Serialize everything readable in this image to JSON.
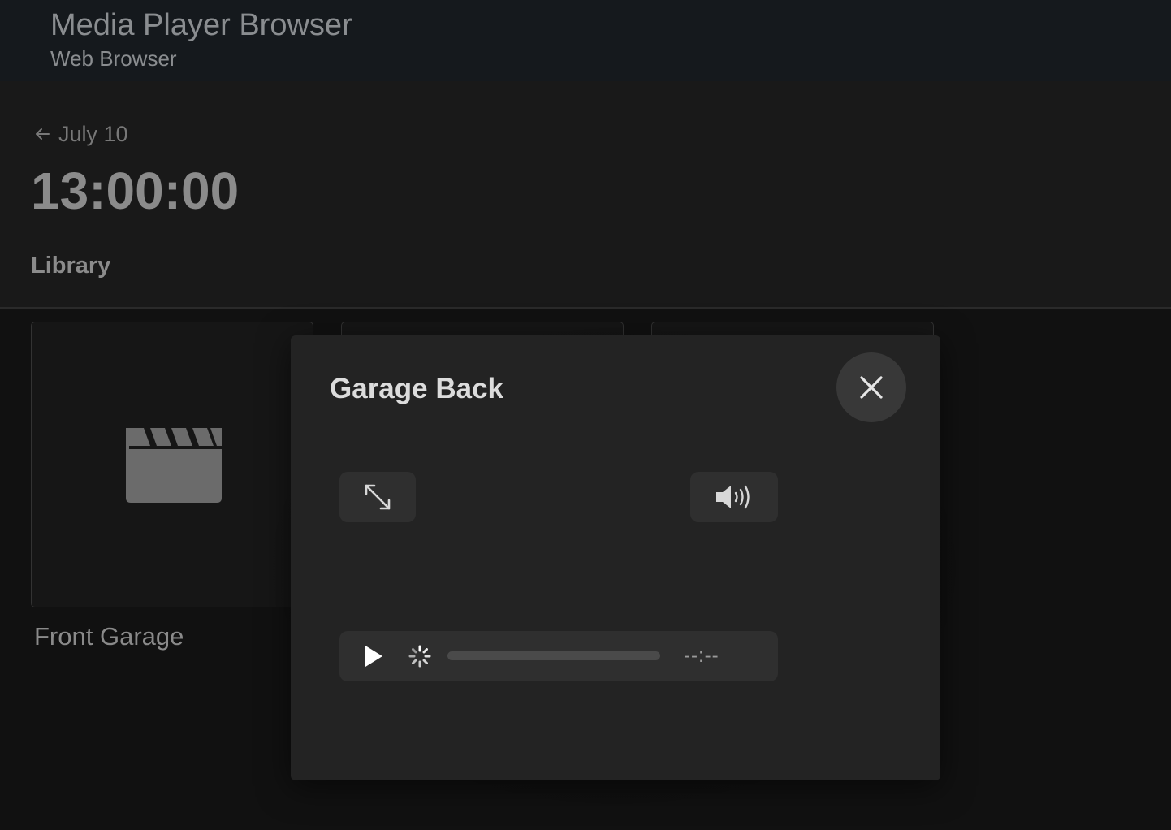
{
  "app": {
    "title": "Media Player Browser",
    "subtitle": "Web Browser"
  },
  "header": {
    "back_label": "July 10",
    "back_icon": "arrow-left-icon",
    "time": "13:00:00",
    "section": "Library"
  },
  "library": {
    "items": [
      {
        "caption": "Front Garage",
        "icon": "clapperboard-icon"
      },
      {
        "caption": "",
        "icon": ""
      },
      {
        "caption": "",
        "icon": ""
      }
    ]
  },
  "dialog": {
    "title": "Garage Back",
    "close_icon": "close-icon",
    "fullscreen_icon": "expand-icon",
    "volume_icon": "volume-icon",
    "player": {
      "play_icon": "play-icon",
      "loading_icon": "spinner-icon",
      "progress": 0,
      "time": "--:--"
    }
  },
  "colors": {
    "appbar_bg": "#15191d",
    "page_bg": "#111111",
    "dialog_bg": "#232323",
    "control_bg": "#2f2f2f"
  }
}
